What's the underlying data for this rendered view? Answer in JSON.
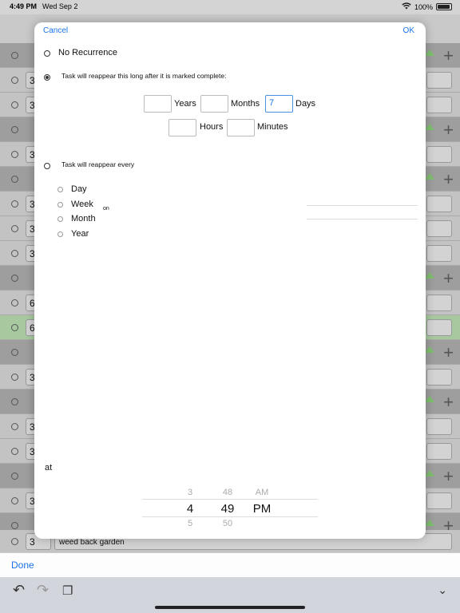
{
  "status": {
    "time": "4:49 PM",
    "date": "Wed Sep 2",
    "battery": "100%"
  },
  "background": {
    "rows": [
      {
        "type": "dark",
        "num": ""
      },
      {
        "type": "light",
        "num": "3"
      },
      {
        "type": "light",
        "num": "3"
      },
      {
        "type": "dark",
        "num": ""
      },
      {
        "type": "light",
        "num": "3"
      },
      {
        "type": "dark",
        "num": ""
      },
      {
        "type": "light",
        "num": "3"
      },
      {
        "type": "light",
        "num": "3"
      },
      {
        "type": "light",
        "num": "3"
      },
      {
        "type": "dark",
        "num": ""
      },
      {
        "type": "light",
        "num": "6"
      },
      {
        "type": "green",
        "num": "6"
      },
      {
        "type": "dark",
        "num": ""
      },
      {
        "type": "light",
        "num": "3"
      },
      {
        "type": "dark",
        "num": ""
      },
      {
        "type": "light",
        "num": "3"
      },
      {
        "type": "light",
        "num": "3"
      },
      {
        "type": "dark",
        "num": ""
      },
      {
        "type": "light",
        "num": "3"
      },
      {
        "type": "dark",
        "num": ""
      }
    ],
    "last_row": {
      "num": "3",
      "task": "weed back garden"
    }
  },
  "modal": {
    "cancel": "Cancel",
    "ok": "OK",
    "no_recurrence": "No Recurrence",
    "after_complete": "Task will reappear this long after it is marked complete:",
    "years_label": "Years",
    "months_label": "Months",
    "days_label": "Days",
    "days_value": "7",
    "hours_label": "Hours",
    "minutes_label": "Minutes",
    "every_label": "Task will reappear every",
    "options": [
      "Day",
      "Week",
      "Month",
      "Year"
    ],
    "on_label": "on",
    "at_label": "at",
    "picker": {
      "hour_above": "3",
      "hour": "4",
      "hour_below": "5",
      "minute_above": "48",
      "minute": "49",
      "minute_below": "50",
      "ampm_above": "AM",
      "ampm": "PM"
    }
  },
  "bottom": {
    "done": "Done"
  }
}
